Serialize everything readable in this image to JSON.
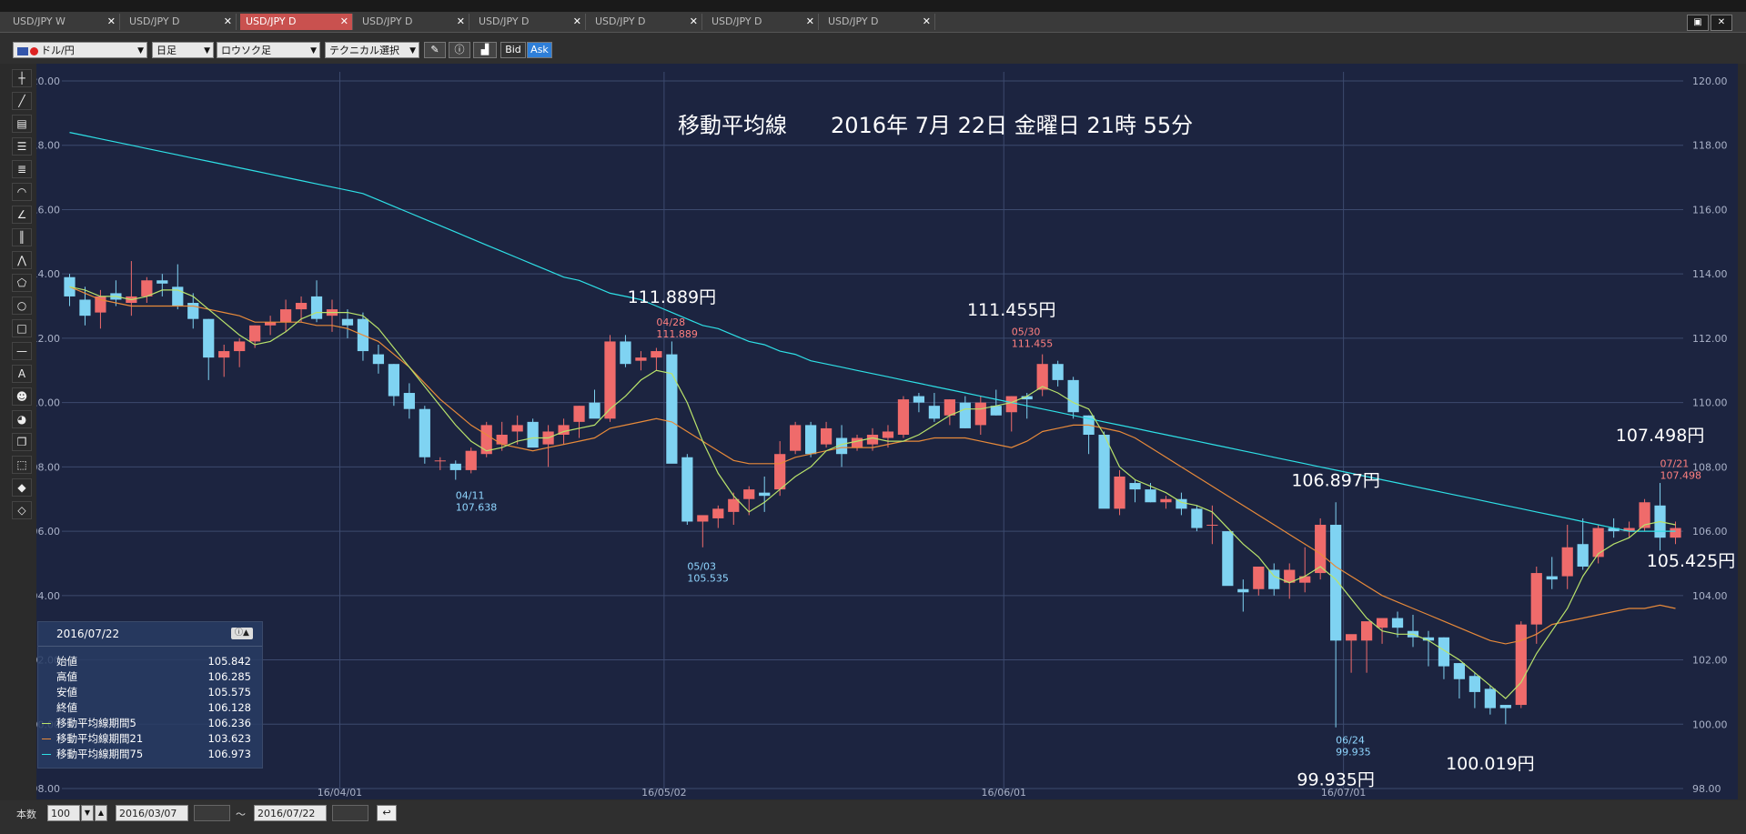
{
  "tabs": [
    {
      "label": "USD/JPY W",
      "active": false
    },
    {
      "label": "USD/JPY D",
      "active": false
    },
    {
      "label": "USD/JPY D",
      "active": true
    },
    {
      "label": "USD/JPY D",
      "active": false
    },
    {
      "label": "USD/JPY D",
      "active": false
    },
    {
      "label": "USD/JPY D",
      "active": false
    },
    {
      "label": "USD/JPY D",
      "active": false
    },
    {
      "label": "USD/JPY D",
      "active": false
    }
  ],
  "tab_close_glyph": "✕",
  "toolbar": {
    "pair": "ドル/円",
    "period": "日足",
    "chart_type": "ロウソク足",
    "technical": "テクニカル選択",
    "bid": "Bid",
    "ask": "Ask"
  },
  "bottom": {
    "count_label": "本数",
    "count_value": "100",
    "from_date": "2016/03/07",
    "tilde": "～",
    "to_date": "2016/07/22"
  },
  "info": {
    "date": "2016/07/22",
    "rows": [
      {
        "label": "始値",
        "value": "105.842",
        "color": ""
      },
      {
        "label": "高値",
        "value": "106.285",
        "color": ""
      },
      {
        "label": "安値",
        "value": "105.575",
        "color": ""
      },
      {
        "label": "終値",
        "value": "106.128",
        "color": ""
      },
      {
        "label": "移動平均線期間5",
        "value": "106.236",
        "color": "#b9e36b"
      },
      {
        "label": "移動平均線期間21",
        "value": "103.623",
        "color": "#e88a3a"
      },
      {
        "label": "移動平均線期間75",
        "value": "106.973",
        "color": "#2ee0e6"
      }
    ]
  },
  "chart_data": {
    "type": "candlestick",
    "title": "移動平均線　　2016年 7月 22日 金曜日 21時 55分",
    "ylim": [
      98,
      120
    ],
    "y_ticks": [
      "120.00",
      "118.00",
      "116.00",
      "114.00",
      "112.00",
      "110.00",
      "108.00",
      "106.00",
      "104.00",
      "102.00",
      "100.00",
      "98.00"
    ],
    "x_ticks": [
      {
        "label": "16/04/01",
        "index": 18
      },
      {
        "label": "16/05/02",
        "index": 39
      },
      {
        "label": "16/06/01",
        "index": 61
      },
      {
        "label": "16/07/01",
        "index": 83
      }
    ],
    "colors": {
      "up": "#ef6b6b",
      "down": "#7fd3f2",
      "ma5": "#b9e36b",
      "ma21": "#e88a3a",
      "ma75": "#2ee0e6"
    },
    "candles": [
      [
        113.9,
        114.0,
        113.0,
        113.3
      ],
      [
        113.2,
        113.6,
        112.4,
        112.7
      ],
      [
        112.8,
        113.5,
        112.3,
        113.3
      ],
      [
        113.4,
        113.8,
        113.0,
        113.2
      ],
      [
        113.1,
        114.4,
        112.7,
        113.3
      ],
      [
        113.3,
        113.9,
        113.1,
        113.8
      ],
      [
        113.8,
        114.0,
        113.3,
        113.7
      ],
      [
        113.6,
        114.3,
        112.9,
        113.0
      ],
      [
        113.1,
        113.4,
        112.3,
        112.6
      ],
      [
        112.6,
        112.6,
        110.7,
        111.4
      ],
      [
        111.4,
        111.8,
        110.8,
        111.6
      ],
      [
        111.6,
        112.0,
        111.1,
        111.9
      ],
      [
        111.9,
        112.4,
        111.7,
        112.4
      ],
      [
        112.4,
        112.7,
        112.1,
        112.5
      ],
      [
        112.5,
        113.2,
        112.2,
        112.9
      ],
      [
        112.9,
        113.3,
        112.5,
        113.1
      ],
      [
        113.3,
        113.8,
        112.5,
        112.6
      ],
      [
        112.7,
        113.2,
        112.2,
        112.9
      ],
      [
        112.6,
        112.9,
        112.0,
        112.4
      ],
      [
        112.6,
        112.8,
        111.3,
        111.6
      ],
      [
        111.5,
        111.8,
        110.9,
        111.2
      ],
      [
        111.2,
        111.2,
        109.9,
        110.2
      ],
      [
        110.3,
        110.6,
        109.5,
        109.8
      ],
      [
        109.8,
        109.9,
        108.1,
        108.3
      ],
      [
        108.2,
        108.3,
        107.9,
        108.2
      ],
      [
        108.1,
        108.2,
        107.6,
        107.9
      ],
      [
        107.9,
        108.6,
        107.8,
        108.5
      ],
      [
        108.4,
        109.4,
        108.3,
        109.3
      ],
      [
        108.7,
        109.4,
        108.5,
        109.0
      ],
      [
        109.1,
        109.6,
        108.7,
        109.3
      ],
      [
        109.4,
        109.5,
        108.8,
        108.6
      ],
      [
        108.7,
        109.3,
        108.0,
        109.1
      ],
      [
        109.0,
        109.5,
        108.7,
        109.3
      ],
      [
        109.4,
        109.9,
        108.9,
        109.9
      ],
      [
        110.0,
        110.4,
        109.7,
        109.5
      ],
      [
        109.5,
        112.1,
        109.4,
        111.9
      ],
      [
        111.9,
        112.1,
        111.1,
        111.2
      ],
      [
        111.3,
        111.6,
        111.0,
        111.4
      ],
      [
        111.4,
        111.7,
        111.0,
        111.6
      ],
      [
        111.5,
        111.9,
        108.3,
        108.1
      ],
      [
        108.3,
        108.4,
        106.2,
        106.3
      ],
      [
        106.3,
        106.4,
        105.5,
        106.5
      ],
      [
        106.4,
        106.8,
        106.1,
        106.7
      ],
      [
        106.6,
        107.2,
        106.2,
        107.0
      ],
      [
        107.0,
        107.4,
        106.5,
        107.3
      ],
      [
        107.2,
        107.7,
        106.6,
        107.1
      ],
      [
        107.3,
        108.8,
        107.1,
        108.4
      ],
      [
        108.5,
        109.4,
        108.4,
        109.3
      ],
      [
        109.3,
        109.4,
        108.3,
        108.4
      ],
      [
        108.7,
        109.4,
        108.6,
        109.2
      ],
      [
        108.9,
        109.3,
        108.0,
        108.4
      ],
      [
        108.6,
        109.0,
        108.5,
        108.9
      ],
      [
        108.7,
        109.2,
        108.5,
        109.0
      ],
      [
        108.9,
        109.3,
        108.6,
        109.1
      ],
      [
        109.0,
        110.2,
        108.9,
        110.1
      ],
      [
        110.2,
        110.3,
        109.7,
        110.0
      ],
      [
        109.9,
        110.3,
        109.4,
        109.5
      ],
      [
        109.6,
        110.1,
        109.3,
        110.1
      ],
      [
        110.0,
        110.2,
        109.2,
        109.2
      ],
      [
        109.3,
        110.2,
        109.0,
        110.0
      ],
      [
        109.9,
        110.4,
        109.6,
        109.6
      ],
      [
        109.7,
        110.2,
        109.1,
        110.2
      ],
      [
        110.2,
        110.3,
        109.5,
        110.1
      ],
      [
        110.4,
        111.5,
        110.2,
        111.2
      ],
      [
        111.2,
        111.3,
        110.5,
        110.7
      ],
      [
        110.7,
        110.8,
        109.5,
        109.7
      ],
      [
        109.6,
        109.6,
        108.4,
        109.0
      ],
      [
        109.0,
        109.1,
        106.8,
        106.7
      ],
      [
        106.7,
        107.9,
        106.5,
        107.7
      ],
      [
        107.5,
        107.6,
        106.9,
        107.3
      ],
      [
        107.3,
        107.5,
        106.9,
        106.9
      ],
      [
        106.9,
        107.1,
        106.7,
        107.0
      ],
      [
        107.0,
        107.2,
        106.5,
        106.7
      ],
      [
        106.7,
        106.8,
        106.0,
        106.1
      ],
      [
        106.2,
        106.8,
        105.6,
        106.2
      ],
      [
        106.0,
        106.0,
        104.5,
        104.3
      ],
      [
        104.2,
        104.5,
        103.5,
        104.1
      ],
      [
        104.2,
        104.8,
        104.0,
        104.9
      ],
      [
        104.8,
        105.0,
        104.0,
        104.2
      ],
      [
        104.4,
        105.0,
        103.9,
        104.8
      ],
      [
        104.4,
        105.5,
        104.1,
        104.6
      ],
      [
        104.7,
        106.4,
        104.5,
        106.2
      ],
      [
        106.2,
        106.9,
        99.9,
        102.6
      ],
      [
        102.6,
        102.7,
        101.6,
        102.8
      ],
      [
        102.6,
        102.8,
        101.6,
        103.2
      ],
      [
        103.0,
        103.1,
        102.5,
        103.3
      ],
      [
        103.3,
        103.5,
        102.7,
        103.0
      ],
      [
        102.9,
        103.4,
        102.4,
        102.7
      ],
      [
        102.7,
        102.9,
        101.8,
        102.6
      ],
      [
        102.7,
        102.7,
        101.4,
        101.8
      ],
      [
        101.9,
        101.9,
        100.8,
        101.4
      ],
      [
        101.5,
        101.6,
        100.5,
        101.0
      ],
      [
        101.1,
        101.2,
        100.3,
        100.5
      ],
      [
        100.6,
        100.6,
        100.0,
        100.5
      ],
      [
        100.6,
        103.2,
        100.5,
        103.1
      ],
      [
        103.1,
        104.9,
        102.5,
        104.7
      ],
      [
        104.6,
        105.2,
        104.2,
        104.5
      ],
      [
        104.6,
        106.2,
        104.2,
        105.5
      ],
      [
        105.6,
        106.4,
        104.8,
        104.9
      ],
      [
        105.2,
        106.2,
        105.0,
        106.1
      ],
      [
        106.1,
        106.4,
        105.8,
        106.0
      ],
      [
        106.0,
        106.3,
        105.8,
        106.1
      ],
      [
        106.1,
        107.0,
        106.0,
        106.9
      ],
      [
        106.8,
        107.5,
        105.4,
        105.8
      ],
      [
        105.8,
        106.3,
        105.6,
        106.1
      ]
    ],
    "ma5": [
      113.6,
      113.5,
      113.3,
      113.3,
      113.2,
      113.3,
      113.5,
      113.5,
      113.3,
      112.9,
      112.5,
      112.1,
      111.8,
      111.9,
      112.2,
      112.6,
      112.8,
      112.8,
      112.8,
      112.7,
      112.3,
      111.7,
      111.1,
      110.5,
      109.9,
      109.3,
      108.8,
      108.5,
      108.6,
      108.8,
      108.9,
      108.9,
      109.1,
      109.2,
      109.3,
      109.8,
      110.2,
      110.7,
      111.0,
      110.9,
      110.0,
      108.8,
      107.8,
      107.1,
      106.6,
      106.9,
      107.3,
      107.7,
      108.0,
      108.5,
      108.7,
      108.8,
      108.9,
      108.8,
      108.8,
      109.0,
      109.3,
      109.6,
      109.8,
      109.8,
      109.9,
      110.0,
      110.2,
      110.5,
      110.3,
      110.0,
      109.8,
      109.0,
      108.0,
      107.6,
      107.4,
      107.2,
      106.9,
      106.8,
      106.6,
      106.1,
      105.6,
      105.2,
      104.6,
      104.4,
      104.6,
      104.9,
      104.5,
      103.9,
      103.3,
      102.9,
      102.8,
      102.8,
      102.6,
      102.3,
      102.0,
      101.6,
      101.2,
      100.8,
      101.3,
      102.2,
      102.9,
      103.6,
      104.6,
      105.3,
      105.6,
      105.8,
      106.2,
      106.3,
      106.2
    ],
    "ma21": [
      113.6,
      113.4,
      113.2,
      113.1,
      113.0,
      113.0,
      113.0,
      113.0,
      113.0,
      112.9,
      112.8,
      112.7,
      112.5,
      112.5,
      112.5,
      112.5,
      112.4,
      112.4,
      112.3,
      112.1,
      111.9,
      111.5,
      111.1,
      110.6,
      110.1,
      109.7,
      109.3,
      109.0,
      108.7,
      108.6,
      108.5,
      108.6,
      108.7,
      108.8,
      108.9,
      109.2,
      109.3,
      109.4,
      109.5,
      109.4,
      109.1,
      108.8,
      108.5,
      108.2,
      108.1,
      108.1,
      108.1,
      108.3,
      108.4,
      108.5,
      108.6,
      108.6,
      108.6,
      108.7,
      108.8,
      108.8,
      108.9,
      108.9,
      108.9,
      108.8,
      108.7,
      108.6,
      108.8,
      109.1,
      109.2,
      109.3,
      109.3,
      109.2,
      109.1,
      108.9,
      108.6,
      108.3,
      108.0,
      107.7,
      107.4,
      107.1,
      106.8,
      106.5,
      106.2,
      105.9,
      105.6,
      105.3,
      104.9,
      104.6,
      104.3,
      104.0,
      103.8,
      103.6,
      103.4,
      103.2,
      103.0,
      102.8,
      102.6,
      102.5,
      102.6,
      102.8,
      103.1,
      103.2,
      103.3,
      103.4,
      103.5,
      103.6,
      103.6,
      103.7,
      103.6
    ],
    "ma75": [
      118.4,
      118.3,
      118.2,
      118.1,
      118.0,
      117.9,
      117.8,
      117.7,
      117.6,
      117.5,
      117.4,
      117.3,
      117.2,
      117.1,
      117.0,
      116.9,
      116.8,
      116.7,
      116.6,
      116.5,
      116.3,
      116.1,
      115.9,
      115.7,
      115.5,
      115.3,
      115.1,
      114.9,
      114.7,
      114.5,
      114.3,
      114.1,
      113.9,
      113.8,
      113.6,
      113.4,
      113.3,
      113.2,
      113.0,
      112.8,
      112.6,
      112.4,
      112.3,
      112.1,
      111.9,
      111.8,
      111.6,
      111.5,
      111.3,
      111.2,
      111.1,
      111.0,
      110.9,
      110.8,
      110.7,
      110.6,
      110.5,
      110.4,
      110.3,
      110.2,
      110.1,
      110.0,
      109.9,
      109.8,
      109.7,
      109.6,
      109.5,
      109.4,
      109.3,
      109.2,
      109.1,
      109.0,
      108.9,
      108.8,
      108.7,
      108.6,
      108.5,
      108.4,
      108.3,
      108.2,
      108.1,
      108.0,
      107.9,
      107.8,
      107.7,
      107.6,
      107.5,
      107.4,
      107.3,
      107.2,
      107.1,
      107.0,
      106.9,
      106.8,
      106.7,
      106.6,
      106.5,
      106.4,
      106.3,
      106.2,
      106.1,
      106.0,
      106.0,
      106.0,
      106.0
    ],
    "annotations": [
      {
        "kind": "big",
        "text": "111.889円",
        "index": 39,
        "value": 113.1
      },
      {
        "kind": "red",
        "date": "04/28",
        "value_text": "111.889",
        "index": 38,
        "value": 112.4
      },
      {
        "kind": "big",
        "text": "111.455円",
        "index": 61,
        "value": 112.7
      },
      {
        "kind": "red",
        "date": "05/30",
        "value_text": "111.455",
        "index": 61,
        "value": 112.1
      },
      {
        "kind": "blue",
        "date": "04/11",
        "value_text": "107.638",
        "index": 25,
        "value": 107.0
      },
      {
        "kind": "blue",
        "date": "05/03",
        "value_text": "105.535",
        "index": 40,
        "value": 104.8
      },
      {
        "kind": "big",
        "text": "106.897円",
        "index": 82,
        "value": 107.4
      },
      {
        "kind": "blue",
        "date": "06/24",
        "value_text": "99.935",
        "index": 82,
        "value": 99.4
      },
      {
        "kind": "big",
        "text": "99.935円",
        "index": 82,
        "value": 98.1
      },
      {
        "kind": "big",
        "text": "100.019円",
        "index": 92,
        "value": 98.6
      },
      {
        "kind": "big",
        "text": "107.498円",
        "index": 103,
        "value": 108.8
      },
      {
        "kind": "red",
        "date": "07/21",
        "value_text": "107.498",
        "index": 103,
        "value": 108.0
      },
      {
        "kind": "big",
        "text": "105.425円",
        "index": 105,
        "value": 104.9
      }
    ]
  }
}
